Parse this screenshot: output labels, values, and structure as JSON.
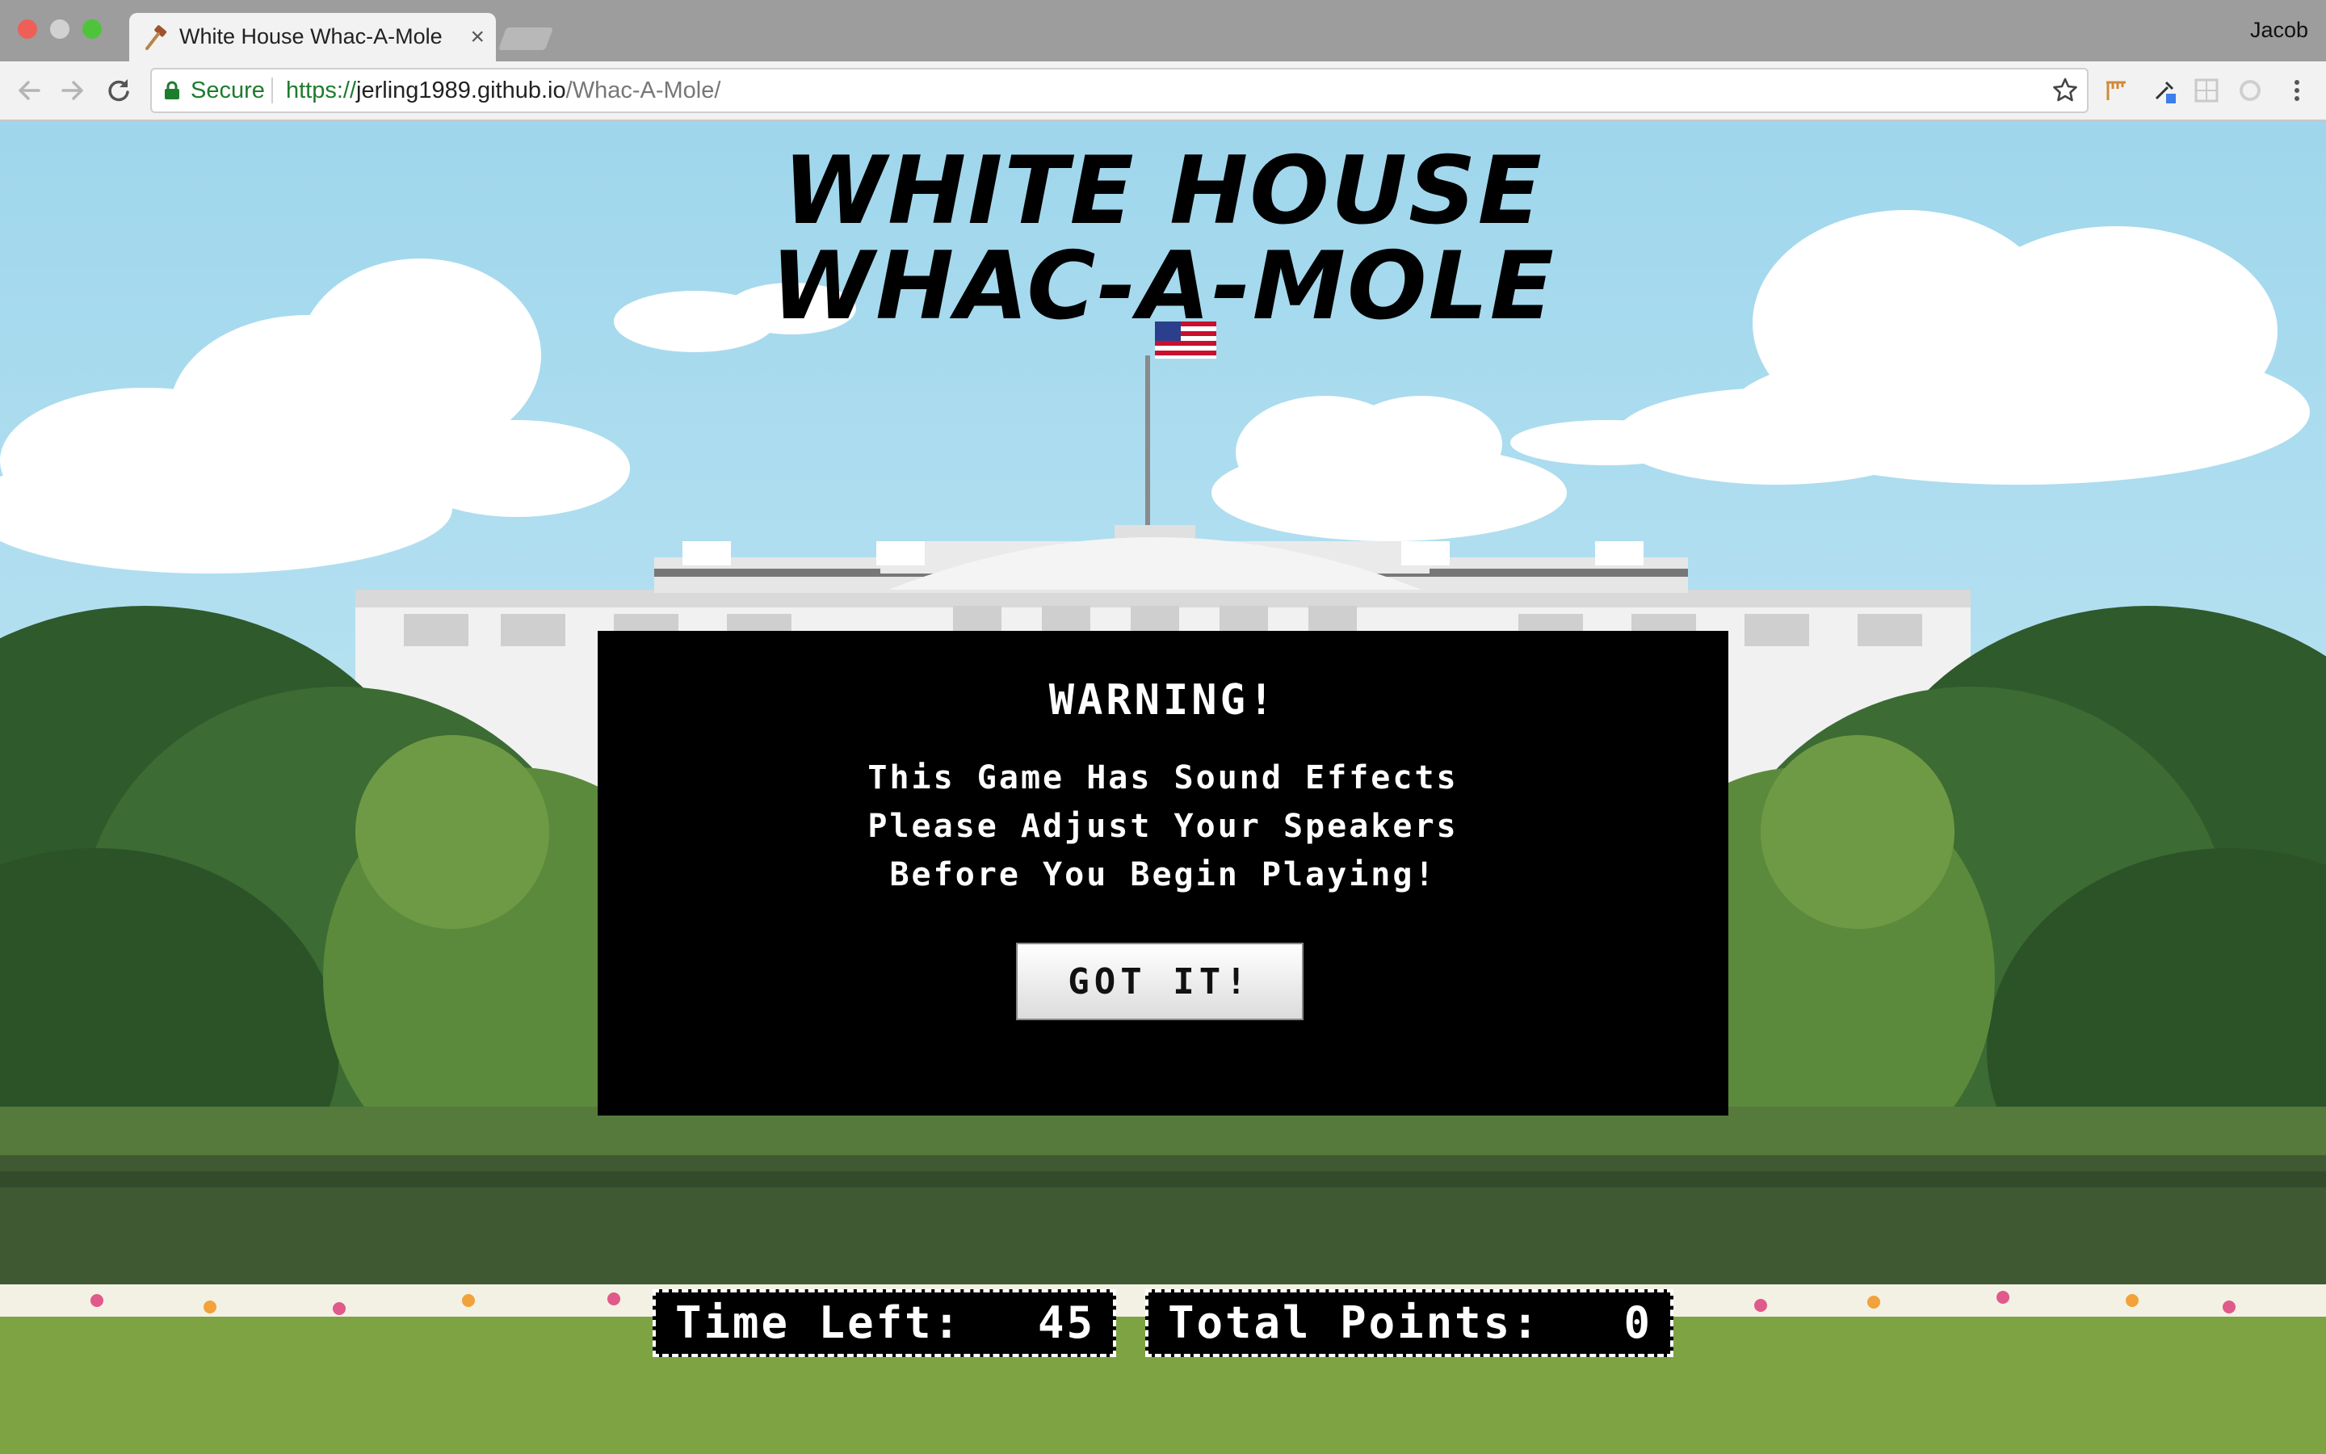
{
  "browser": {
    "tab_title": "White House Whac-A-Mole",
    "tab_close": "×",
    "profile_name": "Jacob",
    "secure_label": "Secure",
    "url_scheme": "https://",
    "url_host": "jerling1989.github.io",
    "url_path": "/Whac-A-Mole/"
  },
  "game": {
    "title_line1": "WHITE HOUSE",
    "title_line2": "WHAC-A-MOLE",
    "warning": {
      "heading": "WARNING!",
      "line1": "This Game Has Sound Effects",
      "line2": "Please Adjust Your Speakers",
      "line3": "Before You Begin Playing!",
      "button_label": "GOT IT!"
    },
    "hud": {
      "time_label": "Time Left:",
      "time_value": "45",
      "points_label": "Total Points:",
      "points_value": "0"
    }
  },
  "colors": {
    "sky": "#9fd6ec",
    "modal_bg": "#000000",
    "modal_text": "#ffffff",
    "lawn": "#7ea342",
    "hedge": "#3f5a33",
    "secure_green": "#1e7c2e"
  },
  "icons": {
    "tab_favicon": "mallet-icon",
    "back": "back-arrow-icon",
    "forward": "forward-arrow-icon",
    "reload": "reload-icon",
    "lock": "lock-icon",
    "bookmark": "star-icon",
    "menu": "kebab-menu-icon"
  }
}
